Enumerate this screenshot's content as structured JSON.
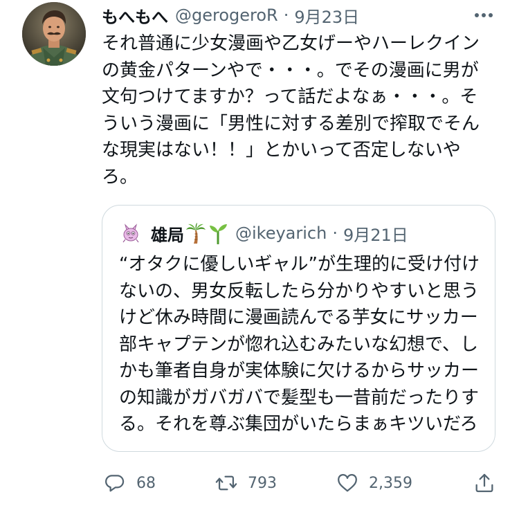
{
  "tweet": {
    "author": {
      "display_name": "もへもへ",
      "handle": "@gerogeroR",
      "avatar_icon": "user-avatar-portrait"
    },
    "separator": "·",
    "date": "9月23日",
    "text_lines": [
      "それ普通に少女漫画や乙女げーやハーレクイン",
      "の黄金パターンやで・・・。でその漫画に男が",
      "文句つけてますか？って話だよなぁ・・・。そ",
      "ういう漫画に「男性に対する差別で搾取でそん",
      "な現実はない！！」とかいって否定しないや",
      "ろ。"
    ]
  },
  "quoted_tweet": {
    "author": {
      "display_name": "雄局",
      "emojis": [
        "palm-tree-emoji",
        "seedling-emoji"
      ],
      "handle": "@ikeyarich",
      "avatar_icon": "pink-creature-avatar"
    },
    "separator": "·",
    "date": "9月21日",
    "text_lines": [
      "“オタクに優しいギャル”が生理的に受け付け",
      "ないの、男女反転したら分かりやすいと思う",
      "けど休み時間に漫画読んでる芋女にサッカー",
      "部キャプテンが惚れ込むみたいな幻想で、し",
      "かも筆者自身が実体験に欠けるからサッカー",
      "の知識がガバガバで髪型も一昔前だったりす",
      "る。それを尊ぶ集団がいたらまぁキツいだろ"
    ]
  },
  "actions": {
    "reply": {
      "icon": "reply-icon",
      "count": "68"
    },
    "retweet": {
      "icon": "retweet-icon",
      "count": "793"
    },
    "like": {
      "icon": "heart-icon",
      "count": "2,359"
    },
    "share": {
      "icon": "share-icon"
    }
  },
  "colors": {
    "text": "#0f1419",
    "secondary": "#536471",
    "border": "#cfd9de"
  }
}
